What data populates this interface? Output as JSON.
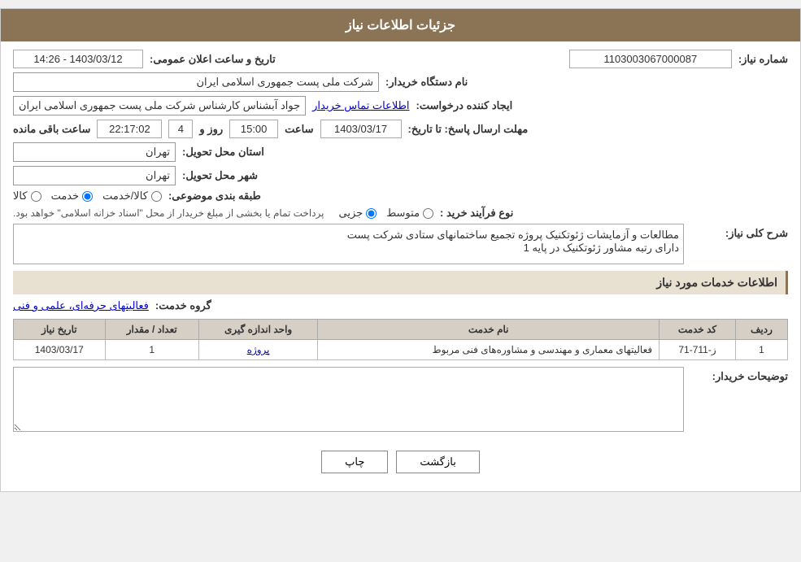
{
  "header": {
    "title": "جزئیات اطلاعات نیاز"
  },
  "fields": {
    "shomareNiaz_label": "شماره نیاز:",
    "shomareNiaz_value": "1103003067000087",
    "namDasgah_label": "نام دستگاه خریدار:",
    "namDasgah_value": "شرکت ملی پست جمهوری اسلامی ایران",
    "iejadKonande_label": "ایجاد کننده درخواست:",
    "iejadKonande_value": "جواد آبشناس کارشناس شرکت ملی پست جمهوری اسلامی ایران",
    "ettelaatTamas_link": "اطلاعات تماس خریدار",
    "mohlatErsal_label": "مهلت ارسال پاسخ: تا تاریخ:",
    "date_value": "1403/03/17",
    "saat_label": "ساعت",
    "saat_value": "15:00",
    "rooz_label": "روز و",
    "rooz_value": "4",
    "baghimande_value": "22:17:02",
    "baghimande_label": "ساعت باقی مانده",
    "ostan_label": "استان محل تحویل:",
    "ostan_value": "تهران",
    "shahr_label": "شهر محل تحویل:",
    "shahr_value": "تهران",
    "tabaghe_label": "طبقه بندی موضوعی:",
    "tabaghe_kala": "کالا",
    "tabaghe_khadamat": "خدمت",
    "tabaghe_kala_khadamat": "کالا/خدمت",
    "tarikh_label": "تاریخ و ساعت اعلان عمومی:",
    "tarikh_value": "1403/03/12 - 14:26",
    "noeFarayand_label": "نوع فرآیند خرید :",
    "noeFarayand_jozii": "جزیی",
    "noeFarayand_motavasset": "متوسط",
    "noeFarayand_note": "پرداخت تمام یا بخشی از مبلغ خریدار از محل \"اسناد خزانه اسلامی\" خواهد بود.",
    "sharhKolliNiaz_label": "شرح کلی نیاز:",
    "sharhKolliNiaz_line1": "مطالعات و آزمایشات ژئوتکنیک پروژه تجمیع ساختمانهای ستادی شرکت پست",
    "sharhKolliNiaz_line2": "دارای رتبه مشاور ژئوتکنیک در پایه 1",
    "ettelaatKhadamat_label": "اطلاعات خدمات مورد نیاز",
    "groohKhadamat_label": "گروه خدمت:",
    "groohKhadamat_value": "فعالیتهای حرفه‌ای، علمی و فنی",
    "table": {
      "headers": [
        "ردیف",
        "کد خدمت",
        "نام خدمت",
        "واحد اندازه گیری",
        "تعداد / مقدار",
        "تاریخ نیاز"
      ],
      "rows": [
        {
          "radif": "1",
          "kodKhadamat": "ز-711-71",
          "namKhadamat": "فعالیتهای معماری و مهندسی و مشاوره‌های فنی مربوط",
          "vahed": "پروژه",
          "tedad": "1",
          "tarikh": "1403/03/17"
        }
      ]
    },
    "توضیحات_label": "توضیحات خریدار:"
  },
  "buttons": {
    "print_label": "چاپ",
    "back_label": "بازگشت"
  },
  "icons": {
    "resize_icon": "⇲"
  }
}
